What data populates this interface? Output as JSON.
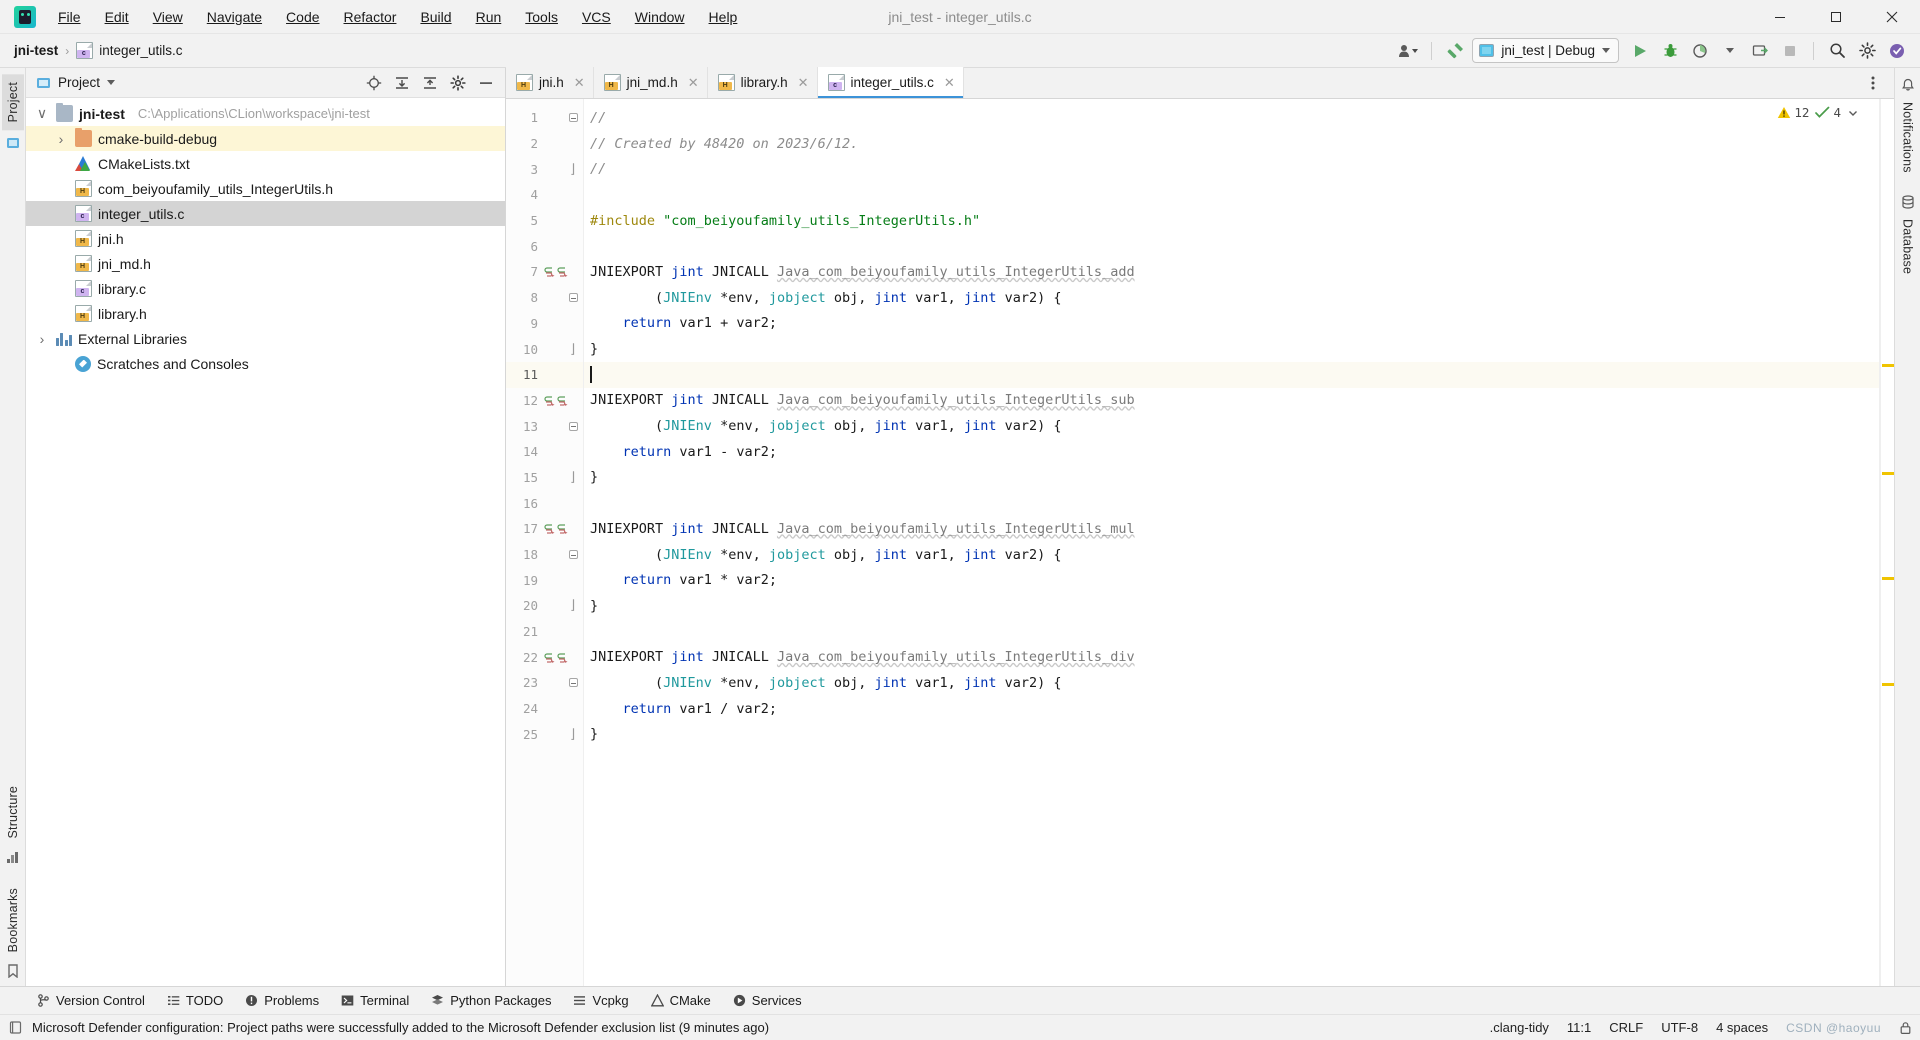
{
  "window": {
    "title": "jni_test - integer_utils.c",
    "controls": {
      "minimize": "–",
      "maximize": "❐",
      "close": "✕"
    }
  },
  "menubar": [
    {
      "label": "File"
    },
    {
      "label": "Edit"
    },
    {
      "label": "View"
    },
    {
      "label": "Navigate"
    },
    {
      "label": "Code"
    },
    {
      "label": "Refactor"
    },
    {
      "label": "Build"
    },
    {
      "label": "Run"
    },
    {
      "label": "Tools"
    },
    {
      "label": "VCS"
    },
    {
      "label": "Window"
    },
    {
      "label": "Help"
    }
  ],
  "navbar": {
    "breadcrumb": [
      "jni-test",
      "integer_utils.c"
    ],
    "separator": "›",
    "run_config": "jni_test | Debug",
    "icons": [
      "account-icon",
      "hammer-build-icon",
      "run-icon",
      "debug-icon",
      "run-with-coverage-icon",
      "profile-icon",
      "attach-to-process-icon",
      "stop-icon",
      "search-everywhere-icon",
      "settings-icon",
      "updates-icon"
    ]
  },
  "left_rail": [
    {
      "label": "Project",
      "active": true
    }
  ],
  "left_rail_bottom": [
    {
      "label": "Structure"
    },
    {
      "label": "Bookmarks"
    }
  ],
  "right_rail": [
    {
      "label": "Notifications"
    },
    {
      "label": "Database"
    }
  ],
  "project_panel": {
    "title": "Project",
    "header_icons": [
      "locate-icon",
      "expand-all-icon",
      "collapse-all-icon",
      "gear-icon",
      "hide-icon"
    ],
    "tree": [
      {
        "indent": 0,
        "twisty": "∨",
        "icon": "folder",
        "label": "jni-test",
        "bold": true,
        "path": "C:\\Applications\\CLion\\workspace\\jni-test",
        "state": "normal"
      },
      {
        "indent": 1,
        "twisty": "›",
        "icon": "folder-orange",
        "label": "cmake-build-debug",
        "state": "highlight"
      },
      {
        "indent": 1,
        "twisty": "",
        "icon": "cmake",
        "label": "CMakeLists.txt",
        "state": "normal"
      },
      {
        "indent": 1,
        "twisty": "",
        "icon": "header",
        "label": "com_beiyoufamily_utils_IntegerUtils.h",
        "state": "normal"
      },
      {
        "indent": 1,
        "twisty": "",
        "icon": "csource",
        "label": "integer_utils.c",
        "state": "selected"
      },
      {
        "indent": 1,
        "twisty": "",
        "icon": "header",
        "label": "jni.h",
        "state": "normal"
      },
      {
        "indent": 1,
        "twisty": "",
        "icon": "header",
        "label": "jni_md.h",
        "state": "normal"
      },
      {
        "indent": 1,
        "twisty": "",
        "icon": "csource",
        "label": "library.c",
        "state": "normal"
      },
      {
        "indent": 1,
        "twisty": "",
        "icon": "header",
        "label": "library.h",
        "state": "normal"
      },
      {
        "indent": 0,
        "twisty": "›",
        "icon": "libraries",
        "label": "External Libraries",
        "state": "normal"
      },
      {
        "indent": 0,
        "twisty": "",
        "icon": "scratches",
        "label": "Scratches and Consoles",
        "state": "normal"
      }
    ]
  },
  "editor": {
    "tabs": [
      {
        "label": "jni.h",
        "icon": "header",
        "active": false
      },
      {
        "label": "jni_md.h",
        "icon": "header",
        "active": false
      },
      {
        "label": "library.h",
        "icon": "header",
        "active": false
      },
      {
        "label": "integer_utils.c",
        "icon": "csource",
        "active": true
      }
    ],
    "more_icon": "more-options-icon",
    "inspections": {
      "warnings": "12",
      "checks": "4",
      "warning_icon": "warning-triangle-icon",
      "ok_icon": "inspection-check-icon"
    },
    "caret_line": 11,
    "lines": [
      {
        "n": 1,
        "fold": "start",
        "tokens": [
          {
            "t": "cmt",
            "s": "//"
          }
        ]
      },
      {
        "n": 2,
        "fold": "",
        "tokens": [
          {
            "t": "cmt",
            "s": "// Created by 48420 on 2023/6/12."
          }
        ]
      },
      {
        "n": 3,
        "fold": "end",
        "tokens": [
          {
            "t": "cmt",
            "s": "//"
          }
        ]
      },
      {
        "n": 4,
        "fold": "",
        "tokens": []
      },
      {
        "n": 5,
        "fold": "",
        "tokens": [
          {
            "t": "pre",
            "s": "#include "
          },
          {
            "t": "str",
            "s": "\"com_beiyoufamily_utils_IntegerUtils.h\""
          }
        ]
      },
      {
        "n": 6,
        "fold": "",
        "tokens": []
      },
      {
        "n": 7,
        "fold": "",
        "marks": "impl",
        "tokens": [
          {
            "t": "pl",
            "s": "JNIEXPORT "
          },
          {
            "t": "kw",
            "s": "jint"
          },
          {
            "t": "pl",
            "s": " JNICALL "
          },
          {
            "t": "fn-u",
            "s": "Java_com_beiyoufamily_utils_IntegerUtils_add"
          }
        ]
      },
      {
        "n": 8,
        "fold": "start",
        "tokens": [
          {
            "t": "pl",
            "s": "        ("
          },
          {
            "t": "typ",
            "s": "JNIEnv"
          },
          {
            "t": "pl",
            "s": " *env, "
          },
          {
            "t": "typ",
            "s": "jobject"
          },
          {
            "t": "pl",
            "s": " obj, "
          },
          {
            "t": "kw",
            "s": "jint"
          },
          {
            "t": "pl",
            "s": " var1, "
          },
          {
            "t": "kw",
            "s": "jint"
          },
          {
            "t": "pl",
            "s": " var2) {"
          }
        ]
      },
      {
        "n": 9,
        "fold": "",
        "tokens": [
          {
            "t": "pl",
            "s": "    "
          },
          {
            "t": "kw",
            "s": "return"
          },
          {
            "t": "pl",
            "s": " var1 + var2;"
          }
        ]
      },
      {
        "n": 10,
        "fold": "end",
        "tokens": [
          {
            "t": "pl",
            "s": "}"
          }
        ]
      },
      {
        "n": 11,
        "fold": "",
        "caret": true,
        "tokens": []
      },
      {
        "n": 12,
        "fold": "",
        "marks": "impl",
        "tokens": [
          {
            "t": "pl",
            "s": "JNIEXPORT "
          },
          {
            "t": "kw",
            "s": "jint"
          },
          {
            "t": "pl",
            "s": " JNICALL "
          },
          {
            "t": "fn-u",
            "s": "Java_com_beiyoufamily_utils_IntegerUtils_sub"
          }
        ]
      },
      {
        "n": 13,
        "fold": "start",
        "tokens": [
          {
            "t": "pl",
            "s": "        ("
          },
          {
            "t": "typ",
            "s": "JNIEnv"
          },
          {
            "t": "pl",
            "s": " *env, "
          },
          {
            "t": "typ",
            "s": "jobject"
          },
          {
            "t": "pl",
            "s": " obj, "
          },
          {
            "t": "kw",
            "s": "jint"
          },
          {
            "t": "pl",
            "s": " var1, "
          },
          {
            "t": "kw",
            "s": "jint"
          },
          {
            "t": "pl",
            "s": " var2) {"
          }
        ]
      },
      {
        "n": 14,
        "fold": "",
        "tokens": [
          {
            "t": "pl",
            "s": "    "
          },
          {
            "t": "kw",
            "s": "return"
          },
          {
            "t": "pl",
            "s": " var1 - var2;"
          }
        ]
      },
      {
        "n": 15,
        "fold": "end",
        "tokens": [
          {
            "t": "pl",
            "s": "}"
          }
        ]
      },
      {
        "n": 16,
        "fold": "",
        "tokens": []
      },
      {
        "n": 17,
        "fold": "",
        "marks": "impl",
        "tokens": [
          {
            "t": "pl",
            "s": "JNIEXPORT "
          },
          {
            "t": "kw",
            "s": "jint"
          },
          {
            "t": "pl",
            "s": " JNICALL "
          },
          {
            "t": "fn-u",
            "s": "Java_com_beiyoufamily_utils_IntegerUtils_mul"
          }
        ]
      },
      {
        "n": 18,
        "fold": "start",
        "tokens": [
          {
            "t": "pl",
            "s": "        ("
          },
          {
            "t": "typ",
            "s": "JNIEnv"
          },
          {
            "t": "pl",
            "s": " *env, "
          },
          {
            "t": "typ",
            "s": "jobject"
          },
          {
            "t": "pl",
            "s": " obj, "
          },
          {
            "t": "kw",
            "s": "jint"
          },
          {
            "t": "pl",
            "s": " var1, "
          },
          {
            "t": "kw",
            "s": "jint"
          },
          {
            "t": "pl",
            "s": " var2) {"
          }
        ]
      },
      {
        "n": 19,
        "fold": "",
        "tokens": [
          {
            "t": "pl",
            "s": "    "
          },
          {
            "t": "kw",
            "s": "return"
          },
          {
            "t": "pl",
            "s": " var1 * var2;"
          }
        ]
      },
      {
        "n": 20,
        "fold": "end",
        "tokens": [
          {
            "t": "pl",
            "s": "}"
          }
        ]
      },
      {
        "n": 21,
        "fold": "",
        "tokens": []
      },
      {
        "n": 22,
        "fold": "",
        "marks": "impl",
        "tokens": [
          {
            "t": "pl",
            "s": "JNIEXPORT "
          },
          {
            "t": "kw",
            "s": "jint"
          },
          {
            "t": "pl",
            "s": " JNICALL "
          },
          {
            "t": "fn-u",
            "s": "Java_com_beiyoufamily_utils_IntegerUtils_div"
          }
        ]
      },
      {
        "n": 23,
        "fold": "start",
        "tokens": [
          {
            "t": "pl",
            "s": "        ("
          },
          {
            "t": "typ",
            "s": "JNIEnv"
          },
          {
            "t": "pl",
            "s": " *env, "
          },
          {
            "t": "typ",
            "s": "jobject"
          },
          {
            "t": "pl",
            "s": " obj, "
          },
          {
            "t": "kw",
            "s": "jint"
          },
          {
            "t": "pl",
            "s": " var1, "
          },
          {
            "t": "kw",
            "s": "jint"
          },
          {
            "t": "pl",
            "s": " var2) {"
          }
        ]
      },
      {
        "n": 24,
        "fold": "",
        "tokens": [
          {
            "t": "pl",
            "s": "    "
          },
          {
            "t": "kw",
            "s": "return"
          },
          {
            "t": "pl",
            "s": " var1 / var2;"
          }
        ]
      },
      {
        "n": 25,
        "fold": "end",
        "tokens": [
          {
            "t": "pl",
            "s": "}"
          }
        ]
      }
    ],
    "markers": [
      265,
      373,
      478,
      584
    ]
  },
  "bottom_tabs": [
    {
      "label": "Version Control",
      "icon": "branch-icon"
    },
    {
      "label": "TODO",
      "icon": "list-icon"
    },
    {
      "label": "Problems",
      "icon": "problems-icon"
    },
    {
      "label": "Terminal",
      "icon": "terminal-icon"
    },
    {
      "label": "Python Packages",
      "icon": "packages-icon"
    },
    {
      "label": "Vcpkg",
      "icon": "vcpkg-icon"
    },
    {
      "label": "CMake",
      "icon": "cmake-icon"
    },
    {
      "label": "Services",
      "icon": "services-icon"
    }
  ],
  "statusbar": {
    "message": "Microsoft Defender configuration: Project paths were successfully added to the Microsoft Defender exclusion list (9 minutes ago)",
    "message_icon": "balloon-icon",
    "inspection_profile": ".clang-tidy",
    "caret_position": "11:1",
    "line_separator": "CRLF",
    "encoding": "UTF-8",
    "indent": "4 spaces",
    "lock_icon": "lock-icon",
    "watermark": "CSDN @haoyuu"
  },
  "colors": {
    "accent": "#3c93d8",
    "keyword": "#0033b3",
    "string": "#067d17",
    "comment": "#8c8c8c",
    "preprocessor": "#9e880d",
    "type": "#20999d",
    "warning": "#f0c400",
    "selection": "#d4d4d4"
  }
}
